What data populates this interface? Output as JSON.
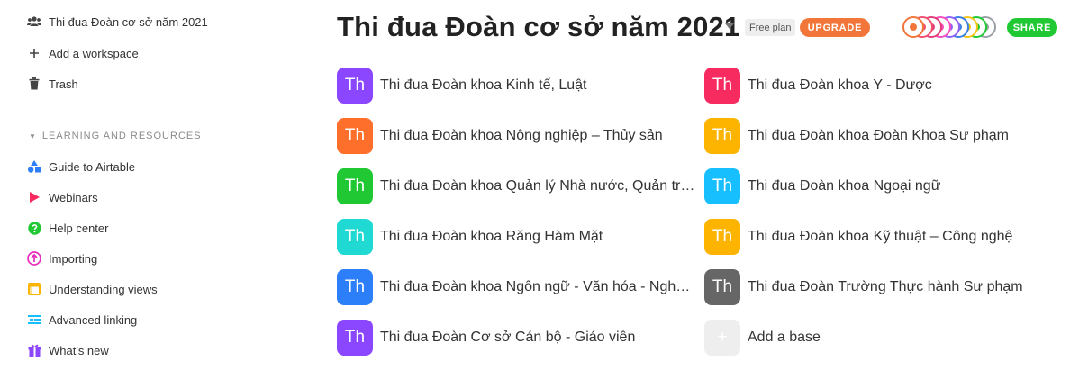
{
  "sidebar": {
    "workspace_label": "Thi đua Đoàn cơ sở năm 2021",
    "add_workspace_label": "Add a workspace",
    "trash_label": "Trash",
    "resources_heading": "LEARNING AND RESOURCES",
    "resources": [
      {
        "label": "Guide to Airtable",
        "icon": "shapes-icon"
      },
      {
        "label": "Webinars",
        "icon": "play-icon"
      },
      {
        "label": "Help center",
        "icon": "help-icon"
      },
      {
        "label": "Importing",
        "icon": "import-icon"
      },
      {
        "label": "Understanding views",
        "icon": "views-icon"
      },
      {
        "label": "Advanced linking",
        "icon": "linking-icon"
      },
      {
        "label": "What's new",
        "icon": "gift-icon"
      }
    ]
  },
  "header": {
    "workspace_title": "Thi đua Đoàn cơ sở năm 2021",
    "plan_label": "Free plan",
    "upgrade_label": "UPGRADE",
    "share_label": "SHARE"
  },
  "colors": {
    "upgrade": "#f2763a",
    "share": "#20c933",
    "avatars": [
      "#f2763a",
      "#f0506e",
      "#e13f7a",
      "#f84fbf",
      "#9063f5",
      "#3b82e6",
      "#f5c518",
      "#20c933",
      "#9aa0a6"
    ]
  },
  "bases": [
    {
      "abbr": "Th",
      "name": "Thi đua Đoàn khoa Kinh tế, Luật",
      "color": "#8b46ff"
    },
    {
      "abbr": "Th",
      "name": "Thi đua Đoàn khoa Y - Dược",
      "color": "#f82b60"
    },
    {
      "abbr": "Th",
      "name": "Thi đua Đoàn khoa Nông nghiệp – Thủy sản",
      "color": "#ff6f2c"
    },
    {
      "abbr": "Th",
      "name": "Thi đua Đoàn khoa Đoàn Khoa Sư phạm",
      "color": "#fcb400"
    },
    {
      "abbr": "Th",
      "name": "Thi đua Đoàn khoa Quản lý Nhà nước, Quản trị Văn phòng",
      "color": "#20c933"
    },
    {
      "abbr": "Th",
      "name": "Thi đua Đoàn khoa Ngoại ngữ",
      "color": "#18bfff"
    },
    {
      "abbr": "Th",
      "name": "Thi đua Đoàn khoa Răng Hàm Mặt",
      "color": "#20d9d2"
    },
    {
      "abbr": "Th",
      "name": "Thi đua Đoàn khoa Kỹ thuật – Công nghệ",
      "color": "#fcb400"
    },
    {
      "abbr": "Th",
      "name": "Thi đua Đoàn khoa Ngôn ngữ - Văn hóa - Nghệ thuật",
      "color": "#2d7ff9"
    },
    {
      "abbr": "Th",
      "name": "Thi đua Đoàn Trường Thực hành Sư phạm",
      "color": "#666666"
    },
    {
      "abbr": "Th",
      "name": "Thi đua Đoàn Cơ sở Cán bộ - Giáo viên",
      "color": "#8b46ff"
    }
  ],
  "add_base_label": "Add a base",
  "add_base_symbol": "+"
}
